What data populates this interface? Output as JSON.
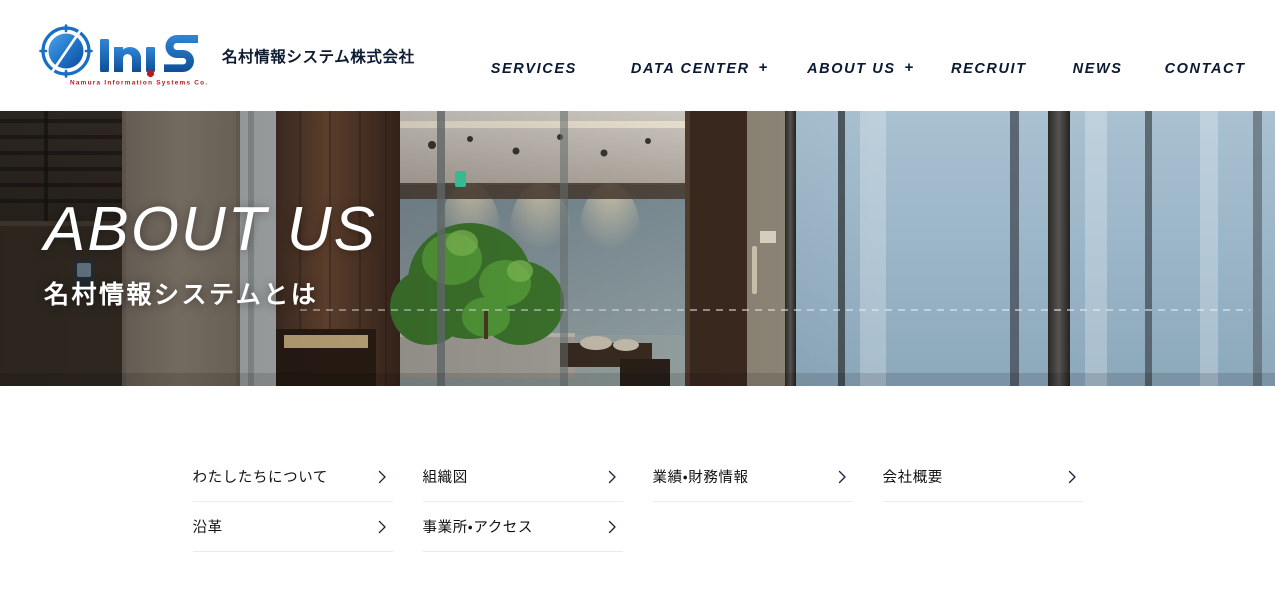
{
  "header": {
    "logo_icon": "inis-compass-logo",
    "logo_wordmark": "iNiS",
    "logo_tagline": "Namura Information Systems Co., Ltd.",
    "brand_name": "名村情報システム株式会社",
    "nav": [
      {
        "label": "SERVICES",
        "has_plus": false,
        "plus": ""
      },
      {
        "label": "DATA CENTER",
        "has_plus": true,
        "plus": "+"
      },
      {
        "label": "ABOUT US",
        "has_plus": true,
        "plus": "+"
      },
      {
        "label": "RECRUIT",
        "has_plus": false,
        "plus": ""
      },
      {
        "label": "NEWS",
        "has_plus": false,
        "plus": ""
      },
      {
        "label": "CONTACT",
        "has_plus": false,
        "plus": ""
      }
    ]
  },
  "hero": {
    "title": "ABOUT US",
    "subtitle": "名村情報システムとは",
    "image_alt": "オフィスエントランスのガラス張りラウンジと観葉植物"
  },
  "links": [
    {
      "label": "わたしたちについて",
      "chevron": "chevron-right-icon"
    },
    {
      "label": "組織図",
      "chevron": "chevron-right-icon"
    },
    {
      "label": "業績・財務情報",
      "chevron": "chevron-right-icon"
    },
    {
      "label": "会社概要",
      "chevron": "chevron-right-icon"
    },
    {
      "label": "沿革",
      "chevron": "chevron-right-icon"
    },
    {
      "label": "事業所・アクセス",
      "chevron": "chevron-right-icon"
    }
  ],
  "colors": {
    "brand_blue": "#1a6fc4",
    "brand_blue_dark": "#0f4e96",
    "nav_text": "#0b1a33",
    "logo_tagline_red": "#c0161d",
    "link_text": "#111111",
    "rule": "#ebebeb"
  }
}
